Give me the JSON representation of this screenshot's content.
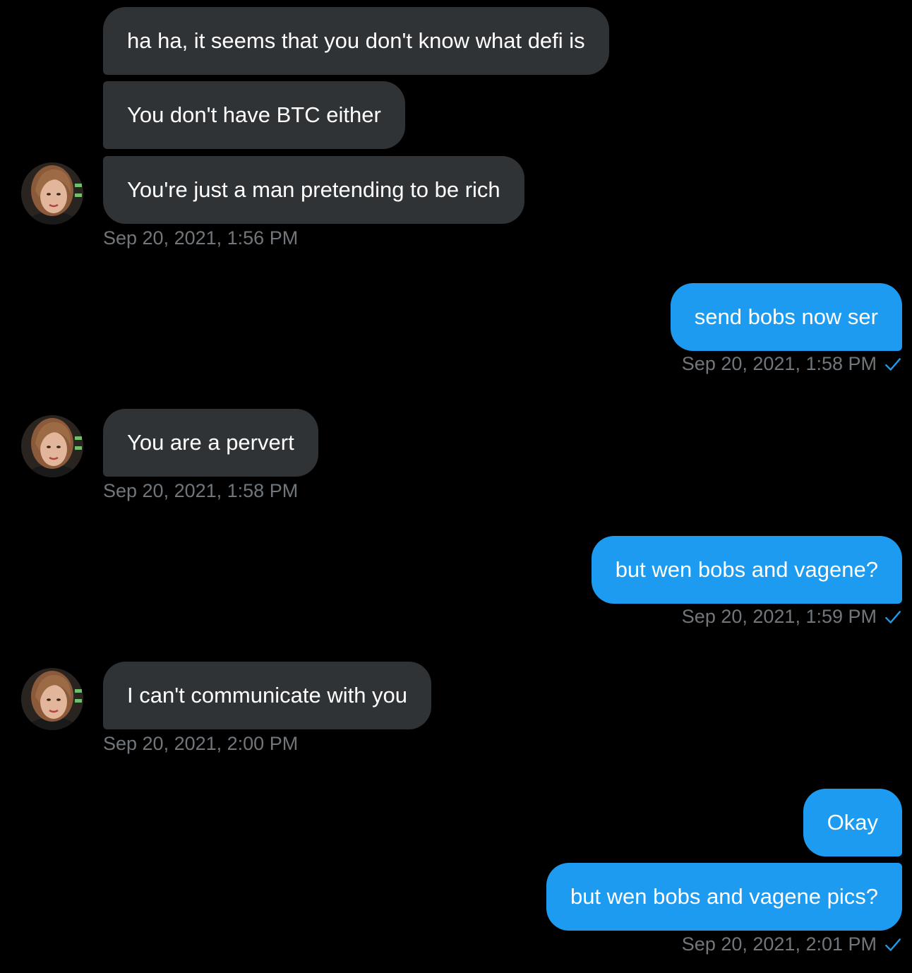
{
  "conversation": {
    "messages": [
      {
        "id": "m1",
        "direction": "incoming",
        "text": "ha ha, it seems that you don't know what defi is"
      },
      {
        "id": "m2",
        "direction": "incoming",
        "text": "You don't have BTC either"
      },
      {
        "id": "m3",
        "direction": "incoming",
        "text": "You're just a man pretending to be rich",
        "timestamp": "Sep 20, 2021, 1:56 PM"
      },
      {
        "id": "m4",
        "direction": "outgoing",
        "text": "send bobs now ser",
        "timestamp": "Sep 20, 2021, 1:58 PM",
        "status_icon": "check-icon"
      },
      {
        "id": "m5",
        "direction": "incoming",
        "text": "You are a pervert",
        "timestamp": "Sep 20, 2021, 1:58 PM"
      },
      {
        "id": "m6",
        "direction": "outgoing",
        "text": "but wen bobs and vagene?",
        "timestamp": "Sep 20, 2021, 1:59 PM",
        "status_icon": "check-icon"
      },
      {
        "id": "m7",
        "direction": "incoming",
        "text": "I can't communicate with you",
        "timestamp": "Sep 20, 2021, 2:00 PM"
      },
      {
        "id": "m8",
        "direction": "outgoing",
        "text": "Okay"
      },
      {
        "id": "m9",
        "direction": "outgoing",
        "text": "but wen bobs and vagene pics?",
        "timestamp": "Sep 20, 2021, 2:01 PM",
        "status_icon": "check-icon"
      }
    ]
  },
  "colors": {
    "background": "#000000",
    "incoming_bubble": "#2f3336",
    "outgoing_bubble": "#1d9bf0",
    "timestamp_text": "#71767b",
    "check_mark": "#1d9bf0"
  }
}
